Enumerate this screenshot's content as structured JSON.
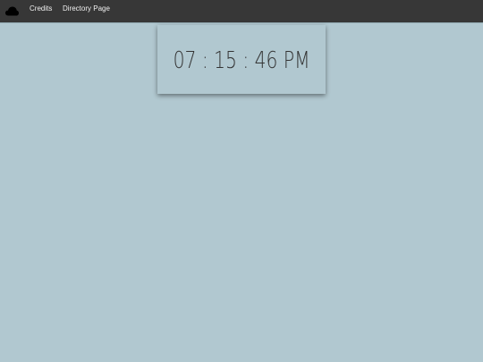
{
  "nav": {
    "logo_icon": "cloud-icon",
    "links": [
      {
        "label": "Credits"
      },
      {
        "label": "Directory Page"
      }
    ]
  },
  "clock": {
    "time": "07 : 15 : 46 PM"
  },
  "colors": {
    "navbar": "#373737",
    "background": "#b1c8d0",
    "clock_text": "#333333"
  }
}
